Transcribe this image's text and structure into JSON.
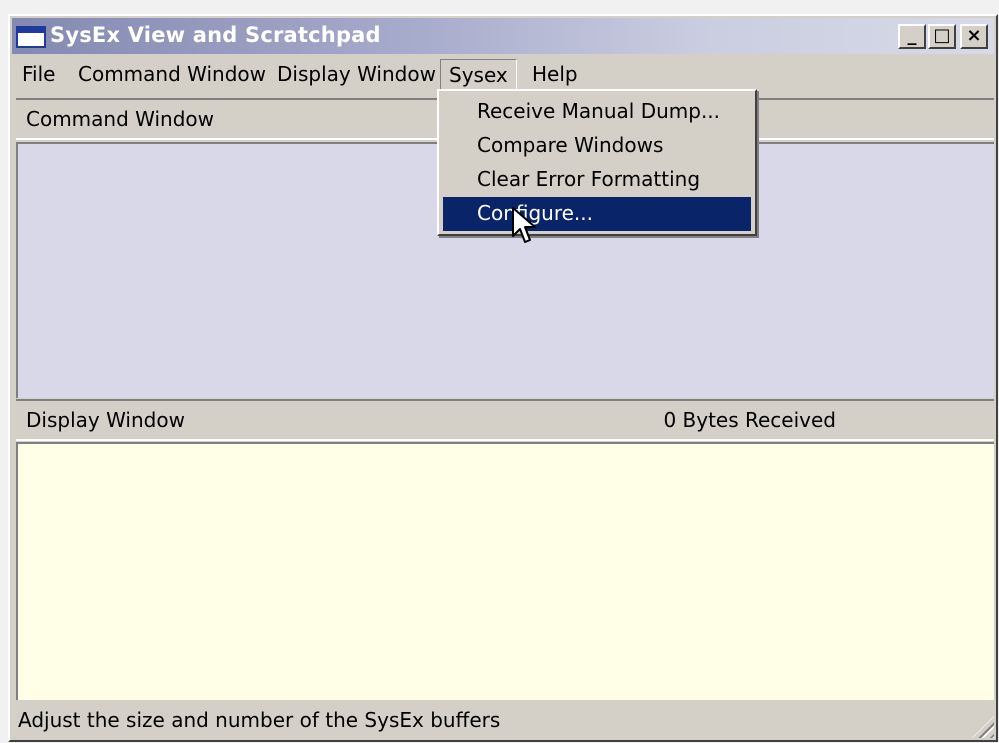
{
  "window": {
    "title": "SysEx View and Scratchpad",
    "controls": {
      "minimize": "_",
      "maximize": "□",
      "close": "×"
    }
  },
  "menubar": {
    "items": [
      {
        "label": "File"
      },
      {
        "label": "Command Window"
      },
      {
        "label": "Display Window"
      },
      {
        "label": "Sysex"
      },
      {
        "label": "Help"
      }
    ]
  },
  "sysex_menu": {
    "items": [
      {
        "label": "Receive Manual Dump..."
      },
      {
        "label": "Compare Windows"
      },
      {
        "label": "Clear Error Formatting"
      },
      {
        "label": "Configure...",
        "selected": true
      }
    ]
  },
  "command_pane": {
    "header": "Command Window"
  },
  "display_pane": {
    "header": "Display Window",
    "bytes_received": "0  Bytes Received"
  },
  "statusbar": {
    "text": "Adjust the size and number of the SysEx buffers"
  },
  "colors": {
    "menu_highlight": "#0a246a",
    "command_bg": "#d8d8e8",
    "display_bg": "#fffee6"
  }
}
